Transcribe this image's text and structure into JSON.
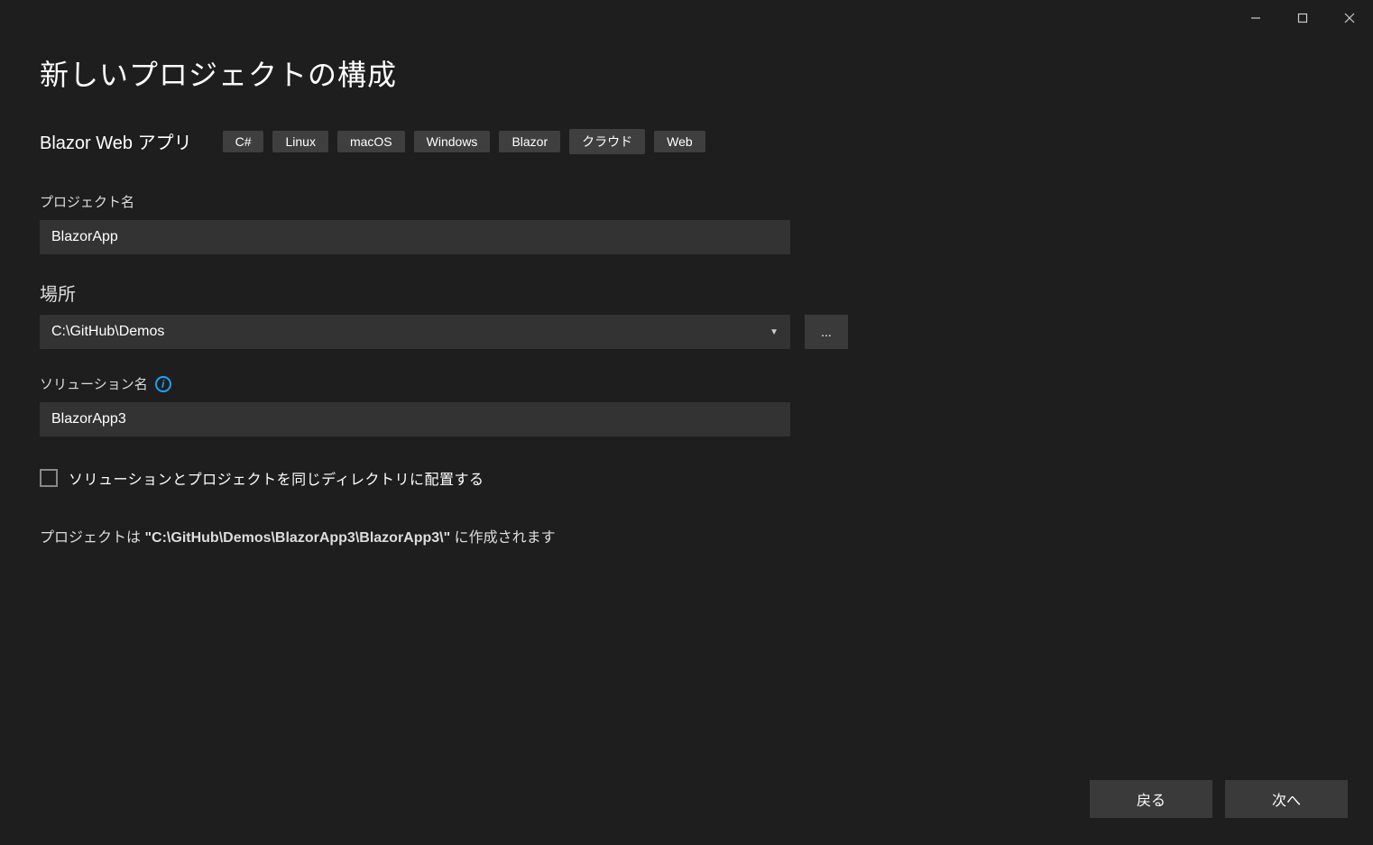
{
  "window": {
    "title": "新しいプロジェクトの構成"
  },
  "subtitle": "Blazor Web アプリ",
  "tags": [
    "C#",
    "Linux",
    "macOS",
    "Windows",
    "Blazor",
    "クラウド",
    "Web"
  ],
  "fields": {
    "project_name": {
      "label": "プロジェクト名",
      "value": "BlazorApp"
    },
    "location": {
      "label": "場所",
      "value": "C:\\GitHub\\Demos",
      "browse": "..."
    },
    "solution_name": {
      "label": "ソリューション名",
      "value": "BlazorApp3"
    }
  },
  "checkbox": {
    "same_dir_label": "ソリューションとプロジェクトを同じディレクトリに配置する",
    "checked": false
  },
  "path_note": {
    "prefix": "プロジェクトは ",
    "path": "\"C:\\GitHub\\Demos\\BlazorApp3\\BlazorApp3\\\"",
    "suffix": " に作成されます"
  },
  "footer": {
    "back": "戻る",
    "next": "次へ"
  }
}
